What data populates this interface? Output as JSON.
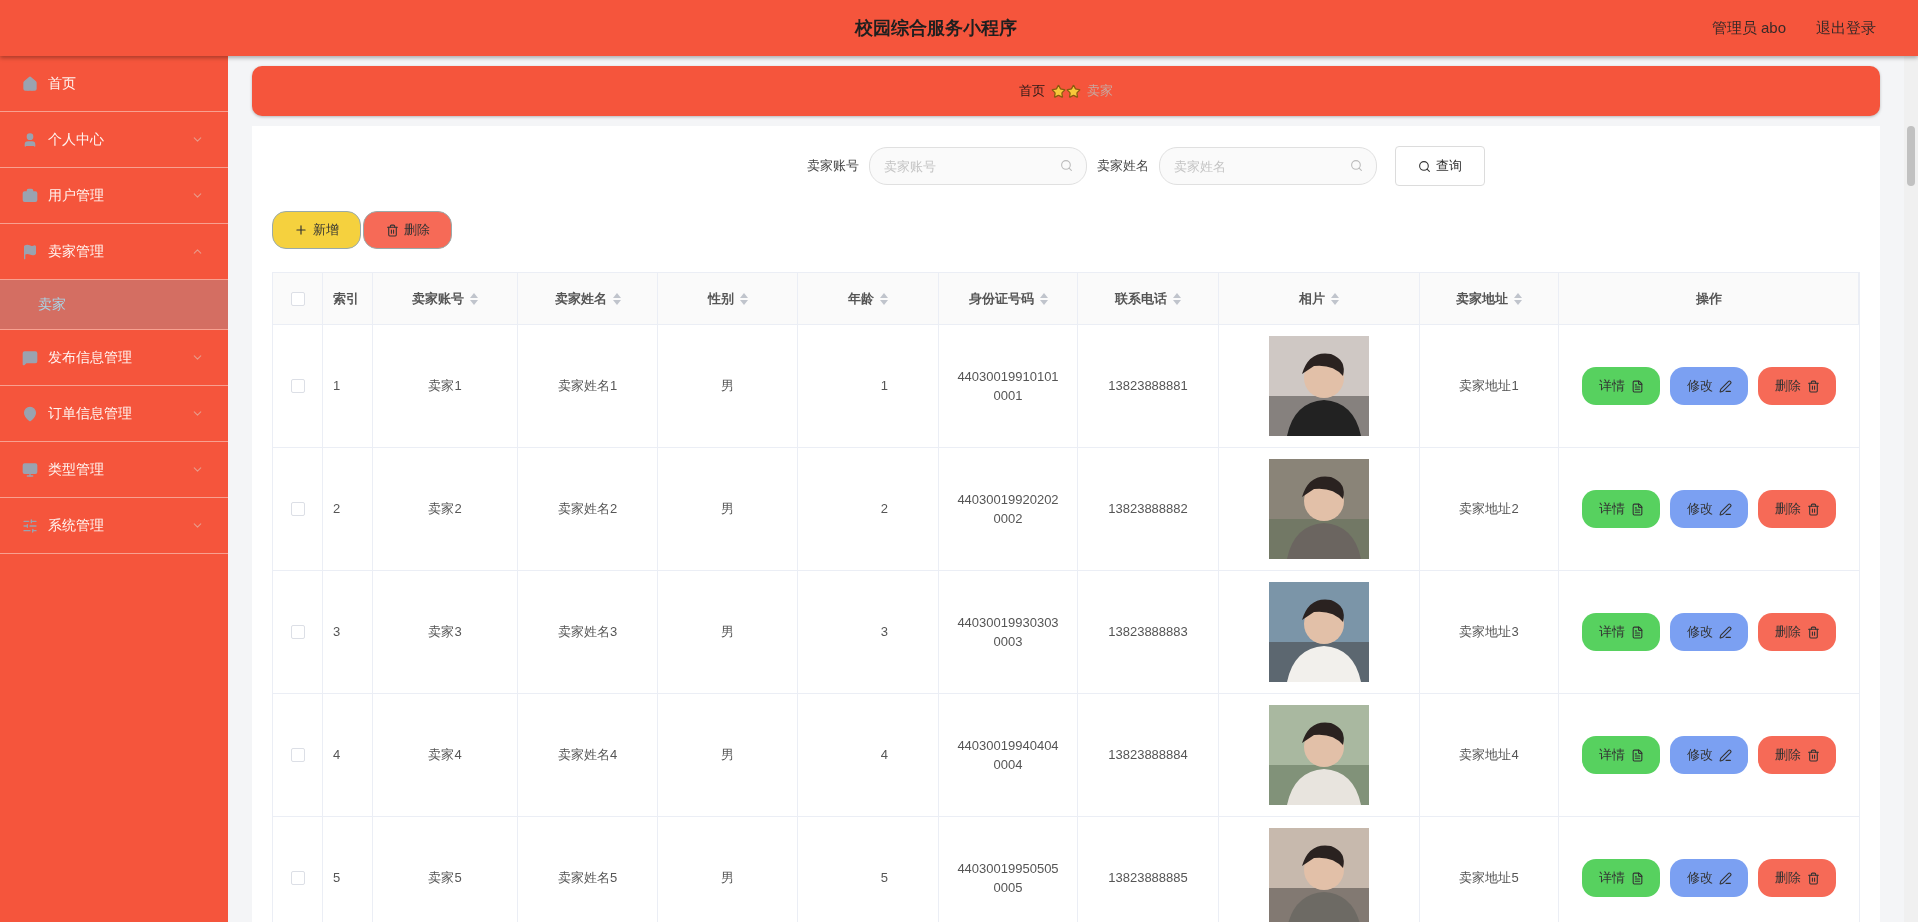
{
  "header": {
    "title": "校园综合服务小程序",
    "user": "管理员 abo",
    "logout": "退出登录"
  },
  "sidebar": {
    "items": [
      {
        "label": "首页",
        "kind": "link"
      },
      {
        "label": "个人中心",
        "kind": "group",
        "expanded": false
      },
      {
        "label": "用户管理",
        "kind": "group",
        "expanded": false
      },
      {
        "label": "卖家管理",
        "kind": "group",
        "expanded": true,
        "children": [
          {
            "label": "卖家",
            "selected": true
          }
        ]
      },
      {
        "label": "发布信息管理",
        "kind": "group",
        "expanded": false
      },
      {
        "label": "订单信息管理",
        "kind": "group",
        "expanded": false
      },
      {
        "label": "类型管理",
        "kind": "group",
        "expanded": false
      },
      {
        "label": "系统管理",
        "kind": "group",
        "expanded": false
      }
    ]
  },
  "breadcrumb": [
    "首页",
    "卖家"
  ],
  "search": {
    "fields": [
      {
        "label": "卖家账号",
        "placeholder": "卖家账号"
      },
      {
        "label": "卖家姓名",
        "placeholder": "卖家姓名"
      }
    ],
    "button": "查询"
  },
  "actions": {
    "add": "新增",
    "delete": "删除"
  },
  "table": {
    "select_all_checked": false,
    "columns": [
      {
        "label": "索引",
        "sortable": false
      },
      {
        "label": "卖家账号",
        "sortable": true
      },
      {
        "label": "卖家姓名",
        "sortable": true
      },
      {
        "label": "性别",
        "sortable": true
      },
      {
        "label": "年龄",
        "sortable": true
      },
      {
        "label": "身份证号码",
        "sortable": true
      },
      {
        "label": "联系电话",
        "sortable": true
      },
      {
        "label": "相片",
        "sortable": true
      },
      {
        "label": "卖家地址",
        "sortable": true
      },
      {
        "label": "操作",
        "sortable": false
      }
    ],
    "rows": [
      {
        "checked": false,
        "index": "1",
        "account": "卖家1",
        "name": "卖家姓名1",
        "gender": "男",
        "age": "1",
        "id_number": "440300199101010001",
        "phone": "13823888881",
        "address": "卖家地址1",
        "buttons": [
          "详情",
          "修改",
          "删除"
        ]
      },
      {
        "checked": false,
        "index": "2",
        "account": "卖家2",
        "name": "卖家姓名2",
        "gender": "男",
        "age": "2",
        "id_number": "440300199202020002",
        "phone": "13823888882",
        "address": "卖家地址2",
        "buttons": [
          "详情",
          "修改",
          "删除"
        ]
      },
      {
        "checked": false,
        "index": "3",
        "account": "卖家3",
        "name": "卖家姓名3",
        "gender": "男",
        "age": "3",
        "id_number": "440300199303030003",
        "phone": "13823888883",
        "address": "卖家地址3",
        "buttons": [
          "详情",
          "修改",
          "删除"
        ]
      },
      {
        "checked": false,
        "index": "4",
        "account": "卖家4",
        "name": "卖家姓名4",
        "gender": "男",
        "age": "4",
        "id_number": "440300199404040004",
        "phone": "13823888884",
        "address": "卖家地址4",
        "buttons": [
          "详情",
          "修改",
          "删除"
        ]
      },
      {
        "checked": false,
        "index": "5",
        "account": "卖家5",
        "name": "卖家姓名5",
        "gender": "男",
        "age": "5",
        "id_number": "440300199505050005",
        "phone": "13823888885",
        "address": "卖家地址5",
        "buttons": [
          "详情",
          "修改",
          "删除"
        ]
      }
    ]
  }
}
